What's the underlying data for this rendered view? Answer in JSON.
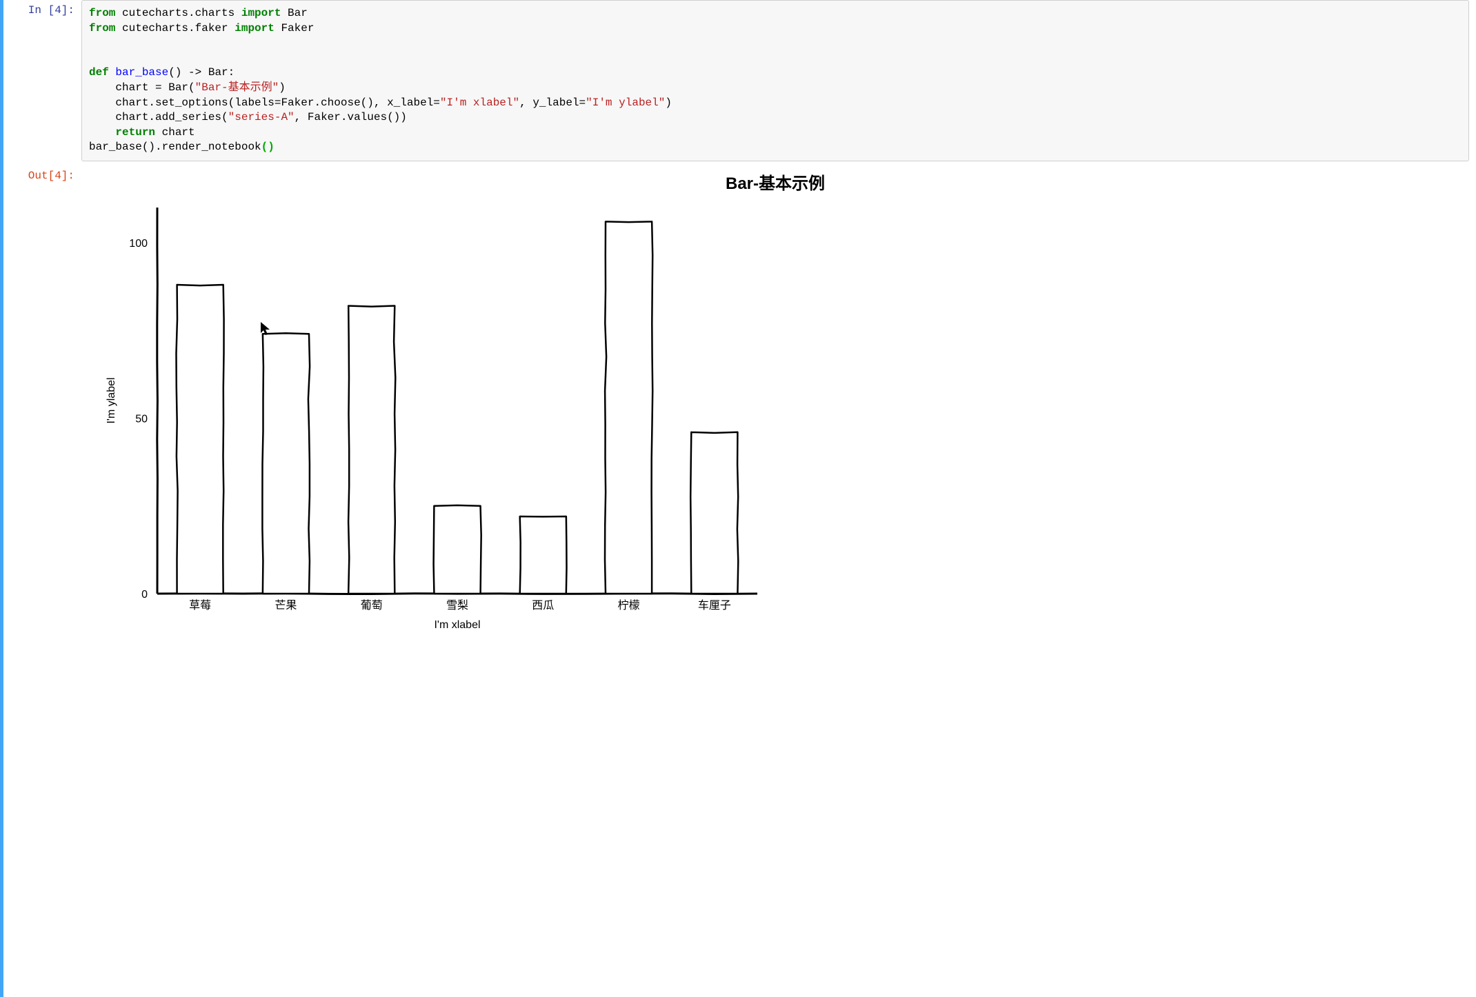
{
  "cell": {
    "in_prompt": "In [4]:",
    "out_prompt": "Out[4]:",
    "code": {
      "l1": {
        "kw1": "from",
        "mod1": " cutecharts.charts ",
        "kw2": "import",
        "nm1": " Bar"
      },
      "l2": {
        "kw1": "from",
        "mod1": " cutecharts.faker ",
        "kw2": "import",
        "nm1": " Faker"
      },
      "l3": {
        "kw1": "def",
        "fn": " bar_base",
        "sig": "() -> Bar:"
      },
      "l4": {
        "p1": "    chart = Bar(",
        "s1": "\"Bar-基本示例\"",
        "p2": ")"
      },
      "l5": {
        "p1": "    chart.set_options(labels=Faker.choose(), x_label=",
        "s1": "\"I'm xlabel\"",
        "p2": ", y_label=",
        "s2": "\"I'm ylabel\"",
        "p3": ")"
      },
      "l6": {
        "p1": "    chart.add_series(",
        "s1": "\"series-A\"",
        "p2": ", Faker.values())"
      },
      "l7": {
        "kw1": "return",
        "p1": " chart"
      },
      "l8": {
        "p1": "bar_base().render_notebook",
        "hl1": "(",
        "hl2": ")"
      }
    }
  },
  "chart_data": {
    "type": "bar",
    "title": "Bar-基本示例",
    "xlabel": "I'm xlabel",
    "ylabel": "I'm ylabel",
    "categories": [
      "草莓",
      "芒果",
      "葡萄",
      "雪梨",
      "西瓜",
      "柠檬",
      "车厘子"
    ],
    "values": [
      88,
      74,
      82,
      25,
      22,
      106,
      46
    ],
    "yticks": [
      0,
      50,
      100
    ],
    "ylim": [
      0,
      110
    ],
    "series_name": "series-A"
  }
}
